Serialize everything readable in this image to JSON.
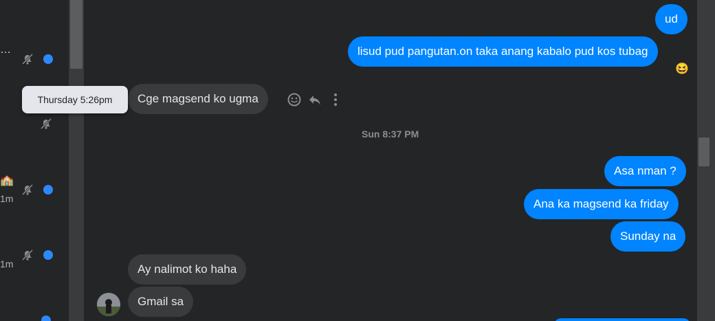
{
  "sidebar": {
    "ellipsis": "…",
    "time_labels": [
      "1m",
      "1m"
    ],
    "emoji": "🏫"
  },
  "hover": {
    "tooltip_time": "Thursday 5:26pm"
  },
  "messages": [
    {
      "dir": "out",
      "text": "ud"
    },
    {
      "dir": "out",
      "text": "lisud pud pangutan.on taka anang kabalo pud kos tubag"
    },
    {
      "dir": "in",
      "text": "Cge magsend ko ugma"
    },
    {
      "dir": "out",
      "text": "Asa nman ?"
    },
    {
      "dir": "out",
      "text": "Ana ka magsend ka friday"
    },
    {
      "dir": "out",
      "text": "Sunday na"
    },
    {
      "dir": "in",
      "text": "Ay nalimot ko haha"
    },
    {
      "dir": "in",
      "text": "Gmail sa"
    }
  ],
  "timestamps": {
    "divider": "Sun 8:37 PM"
  },
  "reactions": {
    "emoji": "😆"
  },
  "icons": {
    "react": "smiley-icon",
    "reply": "reply-icon",
    "more": "more-vertical-icon",
    "mute": "bell-muted-icon"
  },
  "colors": {
    "background": "#242526",
    "outgoing": "#0084ff",
    "incoming": "#3a3b3c",
    "unread_dot": "#2d88ff"
  }
}
